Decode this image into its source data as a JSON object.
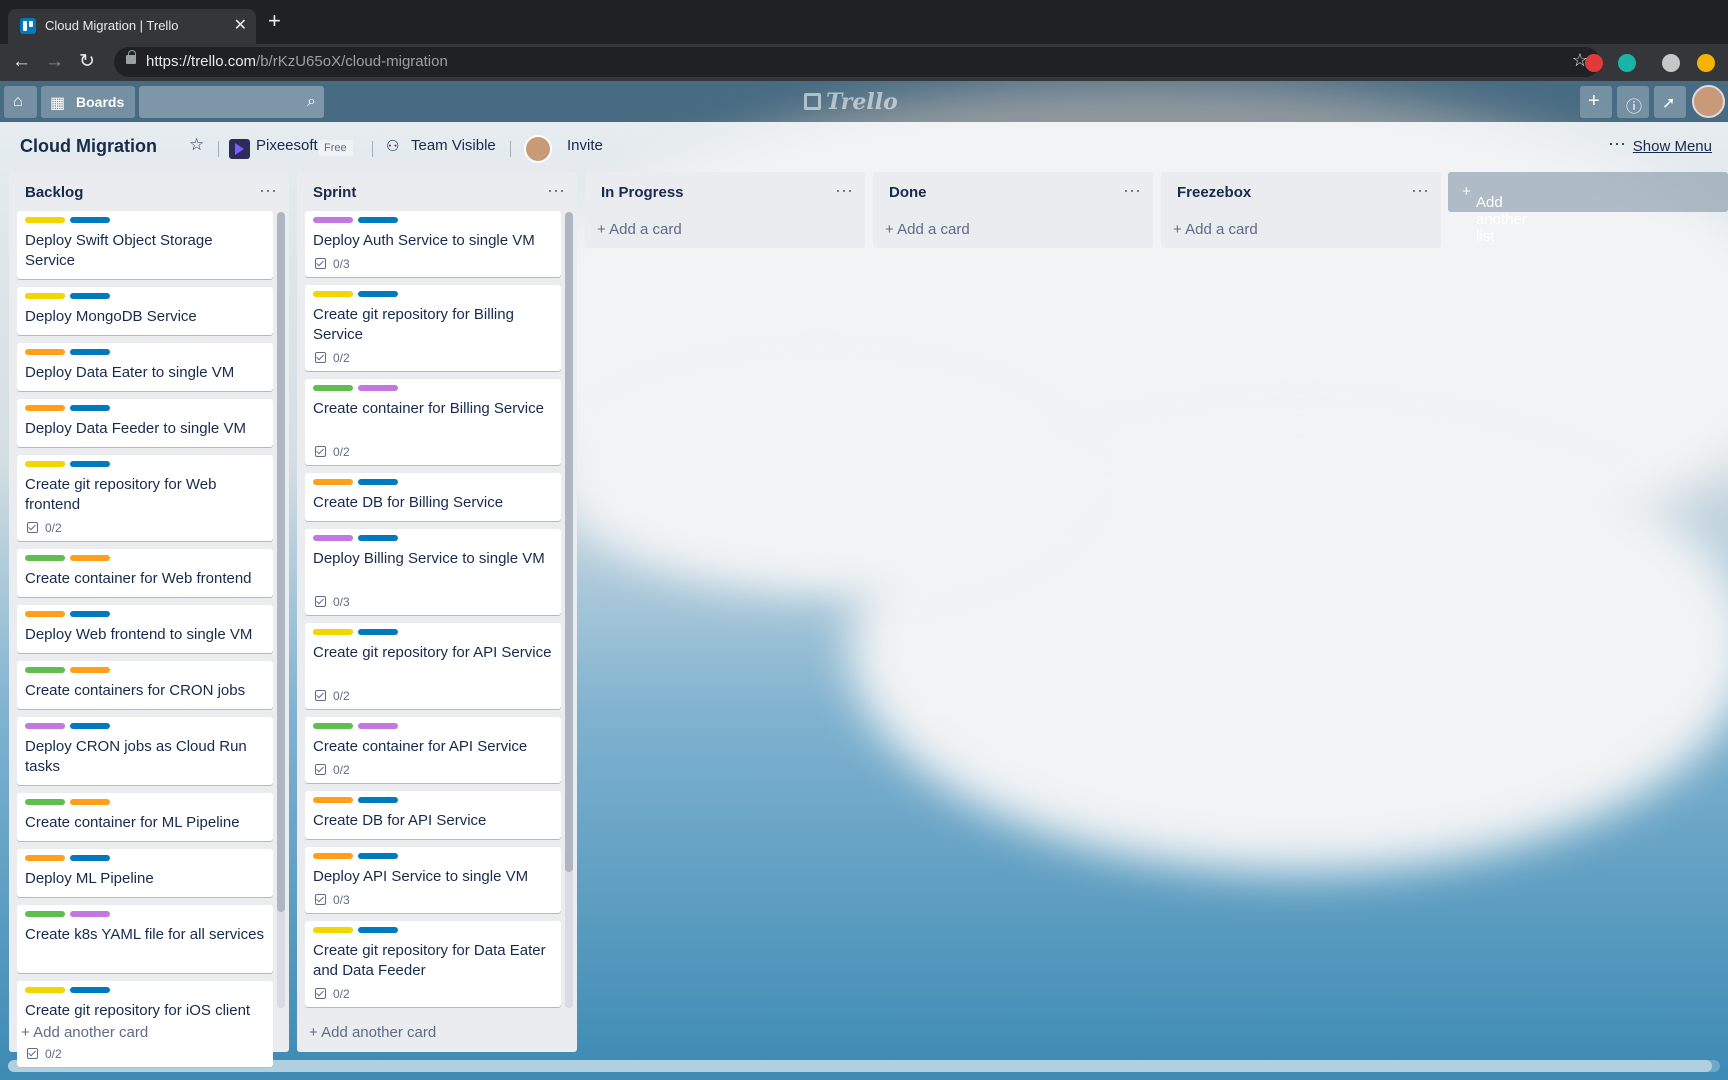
{
  "browser": {
    "tab_title": "Cloud Migration | Trello",
    "url_host": "https://trello.com",
    "url_path": "/b/rKzU65oX/cloud-migration"
  },
  "header": {
    "boards_label": "Boards",
    "search_placeholder": "",
    "logo_text": "Trello"
  },
  "board": {
    "title": "Cloud Migration",
    "workspace": "Pixeesoft",
    "plan_badge": "Free",
    "visibility": "Team Visible",
    "invite_label": "Invite",
    "show_menu_label": "Show Menu",
    "add_list_label": "Add another list"
  },
  "label_colors": {
    "yellow": "#f2d600",
    "blue": "#0079bf",
    "orange": "#ff9f1a",
    "green": "#61bd4f",
    "purple": "#c377e0"
  },
  "lists": [
    {
      "title": "Backlog",
      "add_card_label": "Add another card",
      "cards": [
        {
          "labels": [
            "yellow",
            "blue"
          ],
          "title": "Deploy Swift Object Storage Service",
          "checklist": ""
        },
        {
          "labels": [
            "yellow",
            "blue"
          ],
          "title": "Deploy MongoDB Service",
          "checklist": ""
        },
        {
          "labels": [
            "orange",
            "blue"
          ],
          "title": "Deploy Data Eater to single VM",
          "checklist": ""
        },
        {
          "labels": [
            "orange",
            "blue"
          ],
          "title": "Deploy Data Feeder to single VM",
          "checklist": ""
        },
        {
          "labels": [
            "yellow",
            "blue"
          ],
          "title": "Create git repository for Web frontend",
          "checklist": "0/2"
        },
        {
          "labels": [
            "green",
            "orange"
          ],
          "title": "Create container for Web frontend",
          "checklist": ""
        },
        {
          "labels": [
            "orange",
            "blue"
          ],
          "title": "Deploy Web frontend to single VM",
          "checklist": ""
        },
        {
          "labels": [
            "green",
            "orange"
          ],
          "title": "Create containers for CRON jobs",
          "checklist": ""
        },
        {
          "labels": [
            "purple",
            "blue"
          ],
          "title": "Deploy CRON jobs as Cloud Run tasks",
          "checklist": ""
        },
        {
          "labels": [
            "green",
            "orange"
          ],
          "title": "Create container for ML Pipeline",
          "checklist": ""
        },
        {
          "labels": [
            "orange",
            "blue"
          ],
          "title": "Deploy ML Pipeline",
          "checklist": ""
        },
        {
          "labels": [
            "green",
            "purple"
          ],
          "title": "Create k8s YAML file for all services",
          "checklist": ""
        },
        {
          "labels": [
            "yellow",
            "blue"
          ],
          "title": "Create git repository for iOS client",
          "checklist": "0/2"
        }
      ]
    },
    {
      "title": "Sprint",
      "add_card_label": "Add another card",
      "cards": [
        {
          "labels": [
            "purple",
            "blue"
          ],
          "title": "Deploy Auth Service to single VM",
          "checklist": "0/3"
        },
        {
          "labels": [
            "yellow",
            "blue"
          ],
          "title": "Create git repository for Billing Service",
          "checklist": "0/2"
        },
        {
          "labels": [
            "green",
            "purple"
          ],
          "title": "Create container for Billing Service",
          "checklist": "0/2"
        },
        {
          "labels": [
            "orange",
            "blue"
          ],
          "title": "Create DB for Billing Service",
          "checklist": ""
        },
        {
          "labels": [
            "purple",
            "blue"
          ],
          "title": "Deploy Billing Service to single VM",
          "checklist": "0/3"
        },
        {
          "labels": [
            "yellow",
            "blue"
          ],
          "title": "Create git repository for API Service",
          "checklist": "0/2"
        },
        {
          "labels": [
            "green",
            "purple"
          ],
          "title": "Create container for API Service",
          "checklist": "0/2"
        },
        {
          "labels": [
            "orange",
            "blue"
          ],
          "title": "Create DB for API Service",
          "checklist": ""
        },
        {
          "labels": [
            "orange",
            "blue"
          ],
          "title": "Deploy API Service to single VM",
          "checklist": "0/3"
        },
        {
          "labels": [
            "yellow",
            "blue"
          ],
          "title": "Create git repository for Data Eater and Data Feeder",
          "checklist": "0/2"
        }
      ]
    },
    {
      "title": "In Progress",
      "add_card_label": "Add a card",
      "cards": []
    },
    {
      "title": "Done",
      "add_card_label": "Add a card",
      "cards": []
    },
    {
      "title": "Freezebox",
      "add_card_label": "Add a card",
      "cards": []
    }
  ]
}
